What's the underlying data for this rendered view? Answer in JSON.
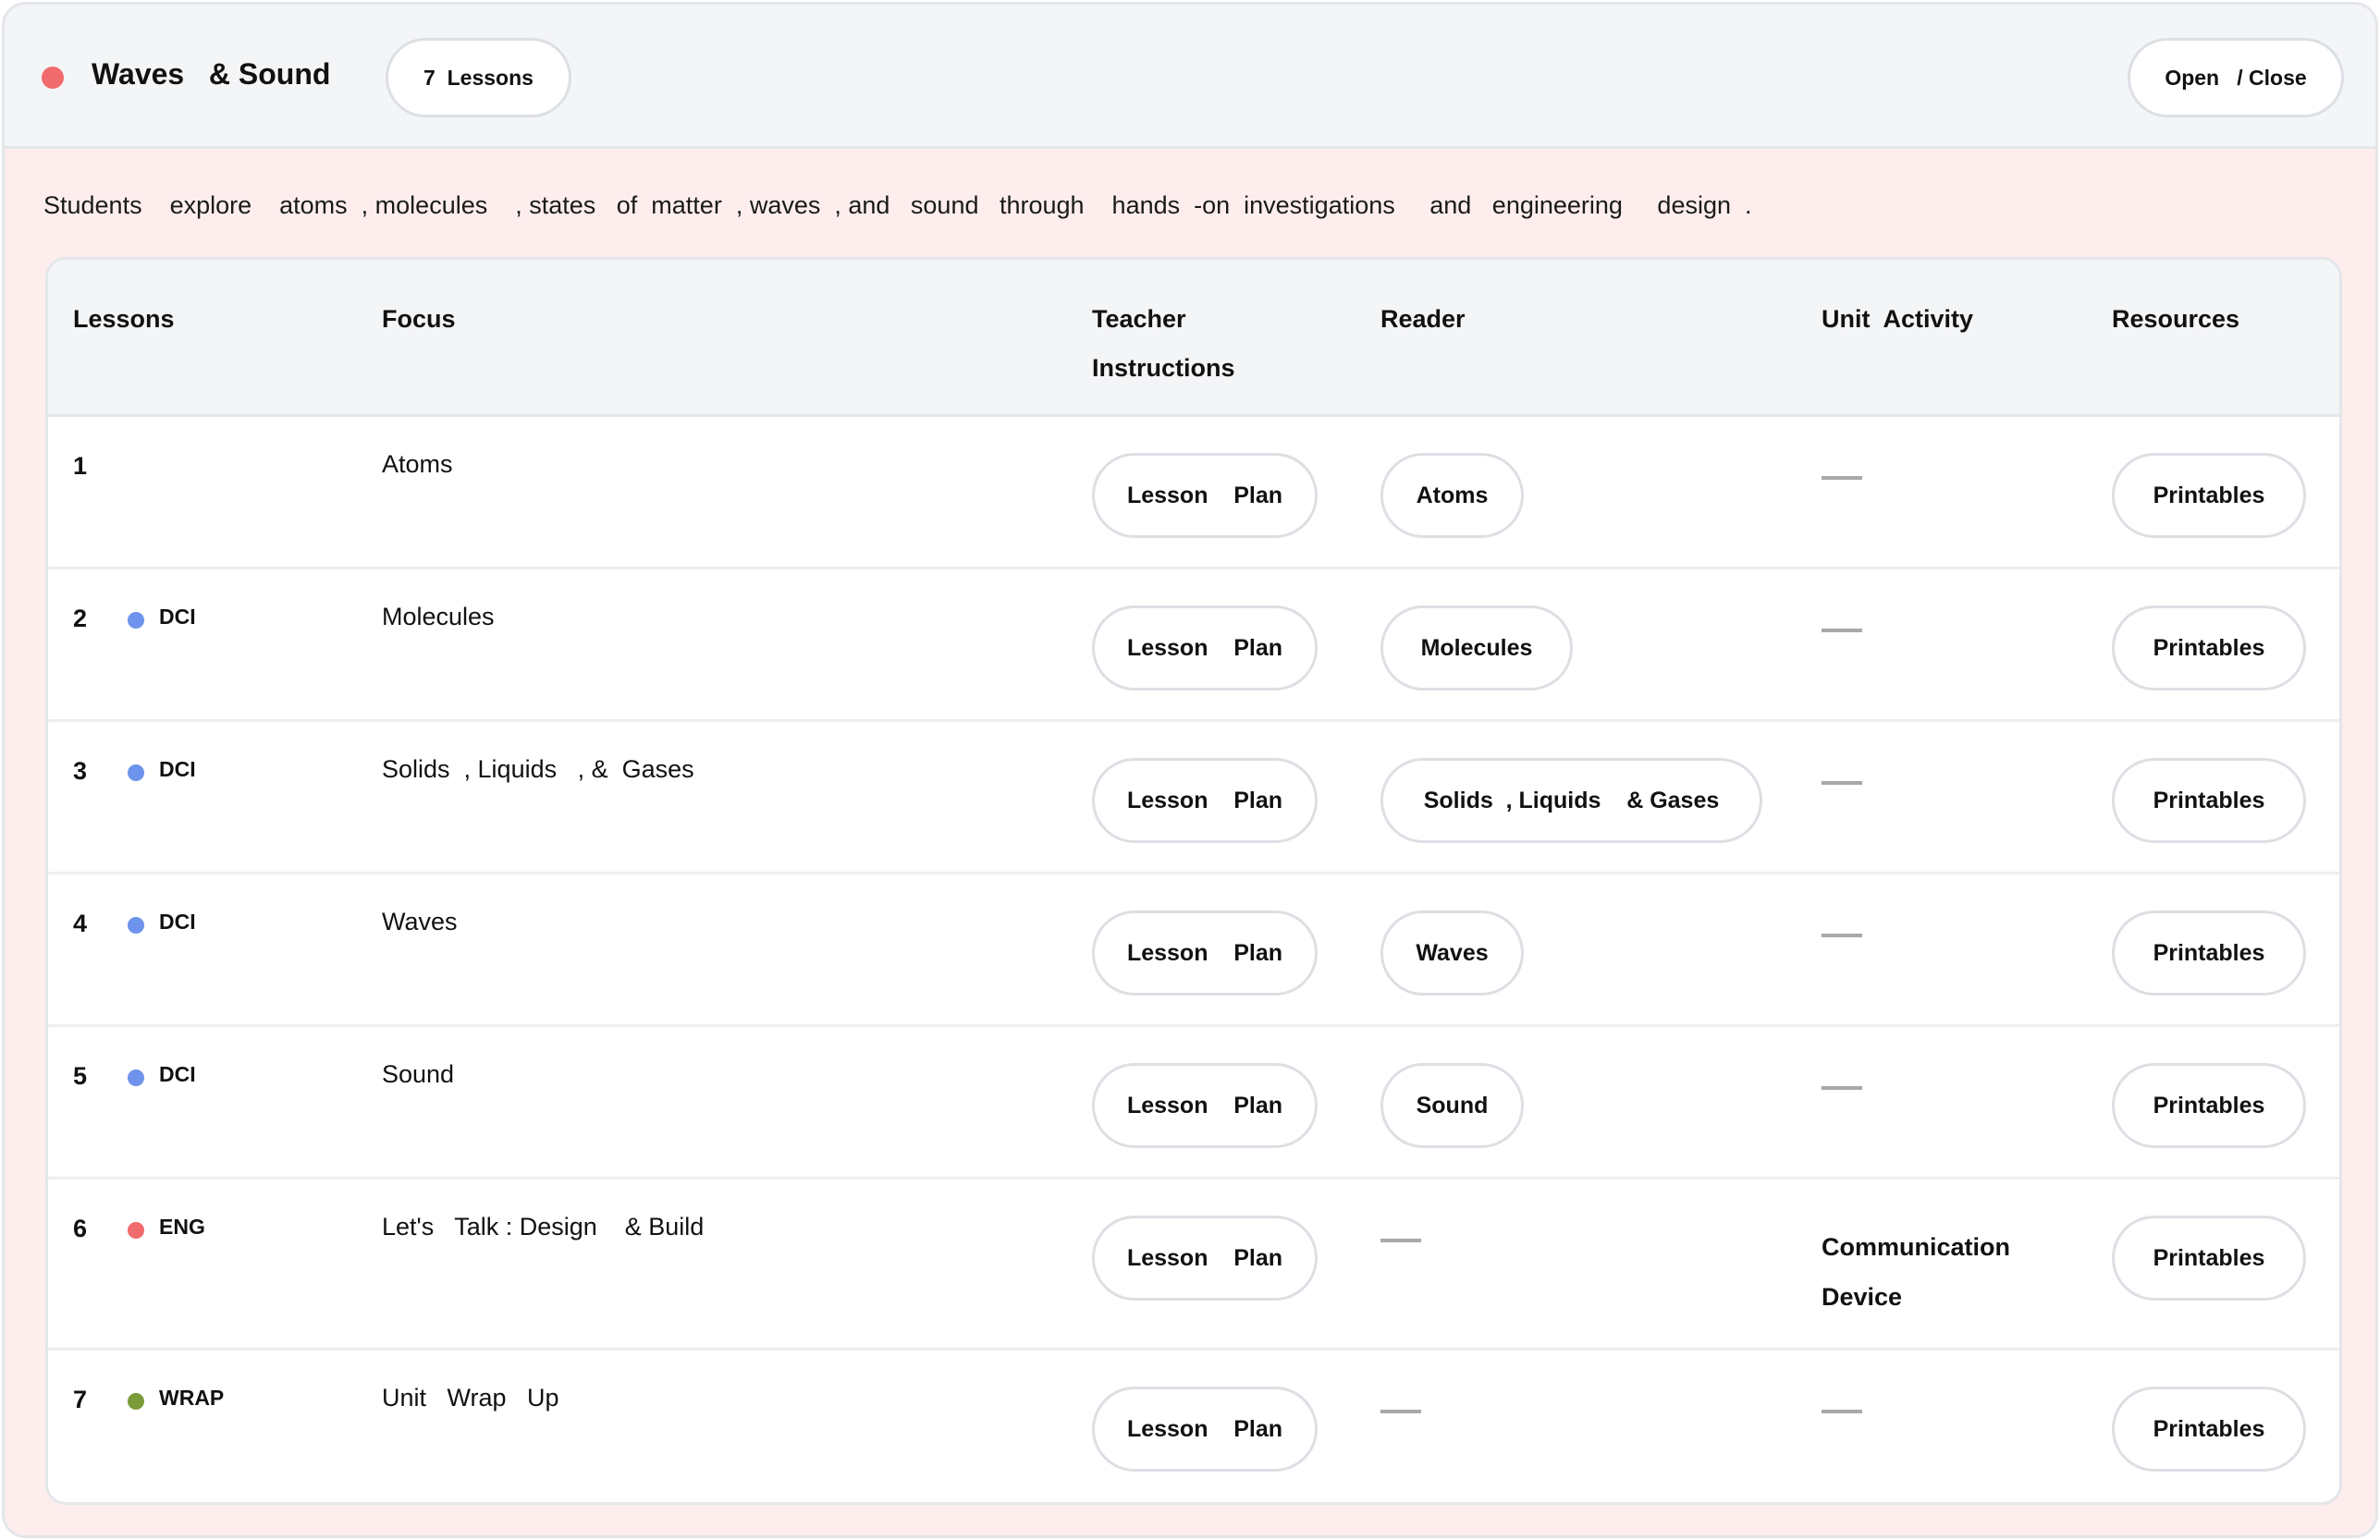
{
  "unit": {
    "status_color": "#f06b6b",
    "title": "Waves   & Sound",
    "lesson_count_label": "7  Lessons",
    "toggle_label": "Open   / Close",
    "description": "Students    explore    atoms  , molecules    , states   of  matter  , waves  , and   sound   through    hands  -on  investigations     and   engineering     design  ."
  },
  "table": {
    "headers": {
      "lessons": "Lessons",
      "focus": "Focus",
      "teacher": "Teacher\nInstructions",
      "reader": "Reader",
      "activity": "Unit  Activity",
      "resources": "Resources"
    },
    "tag_colors": {
      "DCI": "#6e93ec",
      "ENG": "#f06b6b",
      "WRAP": "#7a9b3a"
    },
    "rows": [
      {
        "num": "1",
        "tag": "",
        "focus": "Atoms",
        "teacher": "Lesson    Plan",
        "reader": "Atoms",
        "activity": "",
        "resources": "Printables"
      },
      {
        "num": "2",
        "tag": "DCI",
        "focus": "Molecules",
        "teacher": "Lesson    Plan",
        "reader": "Molecules",
        "activity": "",
        "resources": "Printables"
      },
      {
        "num": "3",
        "tag": "DCI",
        "focus": "Solids  , Liquids   , &  Gases",
        "teacher": "Lesson    Plan",
        "reader": "Solids  , Liquids    & Gases",
        "activity": "",
        "resources": "Printables"
      },
      {
        "num": "4",
        "tag": "DCI",
        "focus": "Waves",
        "teacher": "Lesson    Plan",
        "reader": "Waves",
        "activity": "",
        "resources": "Printables"
      },
      {
        "num": "5",
        "tag": "DCI",
        "focus": "Sound",
        "teacher": "Lesson    Plan",
        "reader": "Sound",
        "activity": "",
        "resources": "Printables"
      },
      {
        "num": "6",
        "tag": "ENG",
        "focus": "Let's   Talk : Design    & Build",
        "teacher": "Lesson    Plan",
        "reader": "",
        "activity": "Communication\nDevice",
        "resources": "Printables"
      },
      {
        "num": "7",
        "tag": "WRAP",
        "focus": "Unit   Wrap   Up",
        "teacher": "Lesson    Plan",
        "reader": "",
        "activity": "",
        "resources": "Printables"
      }
    ]
  }
}
